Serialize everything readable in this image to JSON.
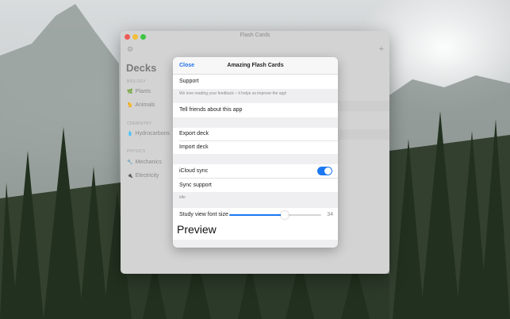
{
  "window": {
    "title": "Flash Cards"
  },
  "toolbar": {
    "settings_icon": "gear-icon",
    "add_icon": "plus-icon"
  },
  "sidebar": {
    "title": "Decks",
    "sections": [
      {
        "header": "BIOLOGY",
        "items": [
          {
            "label": "Plants",
            "icon": "leaf-icon"
          },
          {
            "label": "Animals",
            "icon": "animal-icon"
          }
        ]
      },
      {
        "header": "CHEMISTRY",
        "items": [
          {
            "label": "Hydrocarbons",
            "icon": "drop-icon"
          }
        ]
      },
      {
        "header": "PHYSICS",
        "items": [
          {
            "label": "Mechanics",
            "icon": "wrench-icon"
          },
          {
            "label": "Electricity",
            "icon": "plug-icon"
          }
        ]
      }
    ]
  },
  "sheet": {
    "close_label": "Close",
    "title": "Amazing Flash Cards",
    "support_label": "Support",
    "feedback_note": "We love reading your feedback – it helps us improve the app!",
    "tell_friends_label": "Tell friends about this app",
    "export_label": "Export deck",
    "import_label": "Import deck",
    "icloud_sync_label": "iCloud sync",
    "icloud_sync_on": true,
    "sync_support_label": "Sync support",
    "sync_status": "idle",
    "font_size_label": "Study view font size",
    "font_size_value": "34",
    "font_size_fraction": 0.6,
    "preview_label": "Preview"
  },
  "colors": {
    "accent": "#1b78f2",
    "close_link": "#1d6fe6"
  }
}
